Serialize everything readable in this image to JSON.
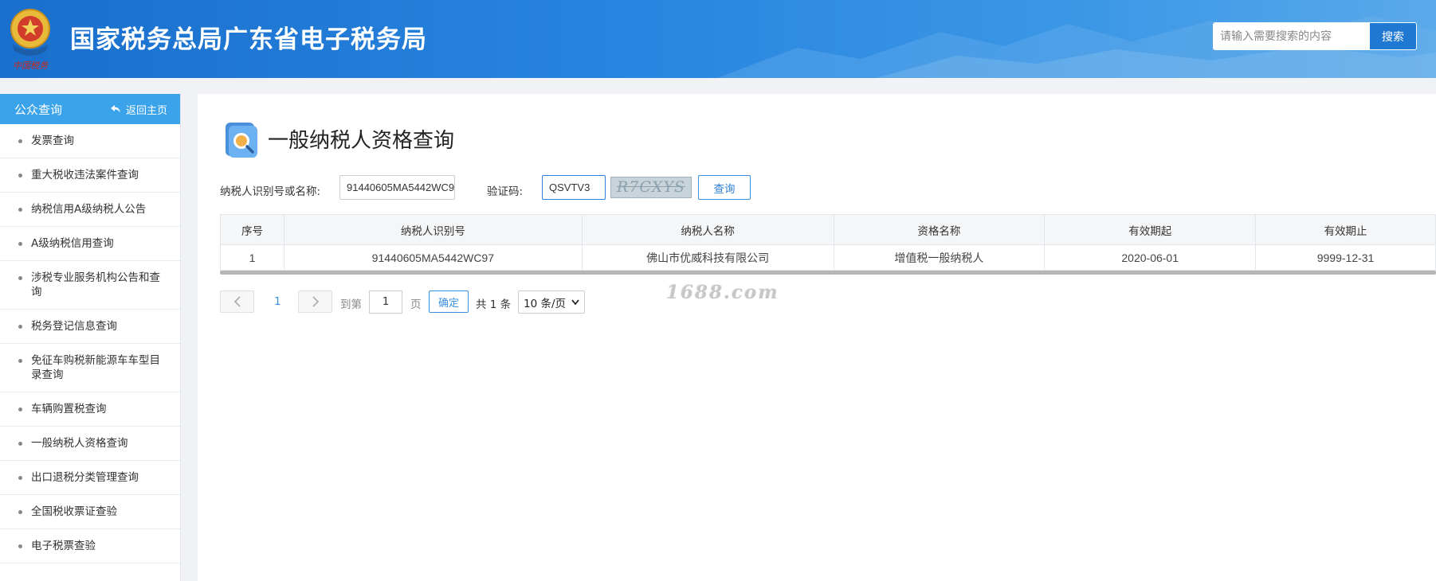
{
  "header": {
    "site_title": "国家税务总局广东省电子税务局",
    "emblem_text": "中国税务",
    "search_placeholder": "请输入需要搜索的内容",
    "search_button": "搜索"
  },
  "sidebar": {
    "title": "公众查询",
    "back_label": "返回主页",
    "items": [
      {
        "label": "发票查询"
      },
      {
        "label": "重大税收违法案件查询"
      },
      {
        "label": "纳税信用A级纳税人公告"
      },
      {
        "label": "A级纳税信用查询"
      },
      {
        "label": "涉税专业服务机构公告和查询"
      },
      {
        "label": "税务登记信息查询"
      },
      {
        "label": "免征车购税新能源车车型目录查询"
      },
      {
        "label": "车辆购置税查询"
      },
      {
        "label": "一般纳税人资格查询"
      },
      {
        "label": "出口退税分类管理查询"
      },
      {
        "label": "全国税收票证查验"
      },
      {
        "label": "电子税票查验"
      }
    ]
  },
  "main": {
    "page_title": "一般纳税人资格查询",
    "form": {
      "taxpayer_label": "纳税人识别号或名称:",
      "taxpayer_value": "91440605MA5442WC9",
      "captcha_label": "验证码:",
      "captcha_value": "QSVTV3",
      "captcha_image_text": "R7CXYS",
      "query_button": "查询"
    },
    "table": {
      "columns": [
        "序号",
        "纳税人识别号",
        "纳税人名称",
        "资格名称",
        "有效期起",
        "有效期止"
      ],
      "rows": [
        [
          "1",
          "91440605MA5442WC97",
          "佛山市优威科技有限公司",
          "增值税一般纳税人",
          "2020-06-01",
          "9999-12-31"
        ]
      ]
    },
    "pager": {
      "prev_icon": "chevron-left-icon",
      "next_icon": "chevron-right-icon",
      "current_page": "1",
      "goto_label": "到第",
      "goto_value": "1",
      "page_unit": "页",
      "confirm": "确定",
      "total": "共 1 条",
      "page_size": "10 条/页"
    }
  },
  "watermark": "1688.com",
  "colors": {
    "header_blue": "#2886e0",
    "sidebar_head": "#3ba3ea",
    "accent": "#2f80d6"
  }
}
